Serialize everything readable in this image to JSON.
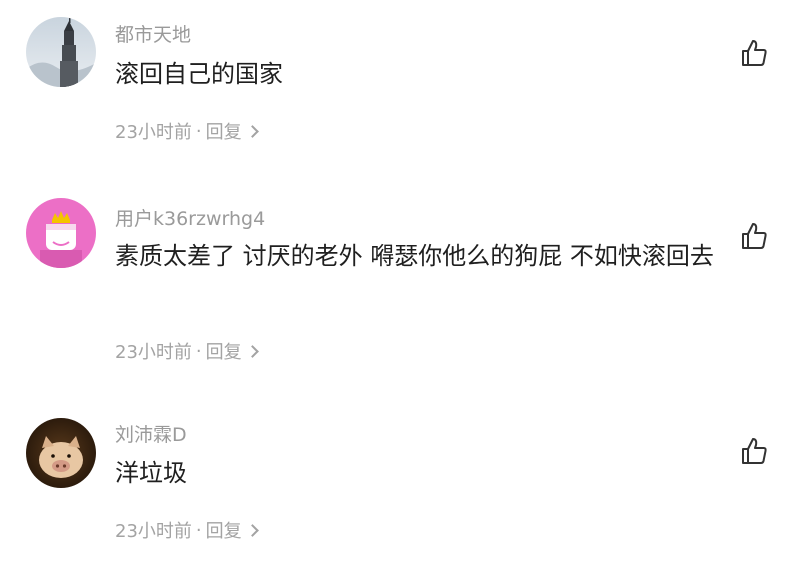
{
  "comments": [
    {
      "username": "都市天地",
      "text": "滚回自己的国家",
      "time": "23小时前",
      "dot": "·",
      "reply": "回复",
      "avatar_icon": "skyscraper-photo-avatar",
      "like_icon": "thumbs-up-icon"
    },
    {
      "username": "用户k36rzwrhg4",
      "text": "素质太差了 讨厌的老外 嘚瑟你他么的狗屁 不如快滚回去",
      "time": "23小时前",
      "dot": "·",
      "reply": "回复",
      "avatar_icon": "crown-character-avatar",
      "like_icon": "thumbs-up-icon"
    },
    {
      "username": "刘沛霖D",
      "text": "洋垃圾",
      "time": "23小时前",
      "dot": "·",
      "reply": "回复",
      "avatar_icon": "pig-photo-avatar",
      "like_icon": "thumbs-up-icon"
    }
  ],
  "colors": {
    "username": "#9a9a9a",
    "text": "#1f1f1f",
    "meta": "#a3a3a3",
    "avatar2_bg": "#ec6fc6",
    "crown": "#f5c400"
  }
}
